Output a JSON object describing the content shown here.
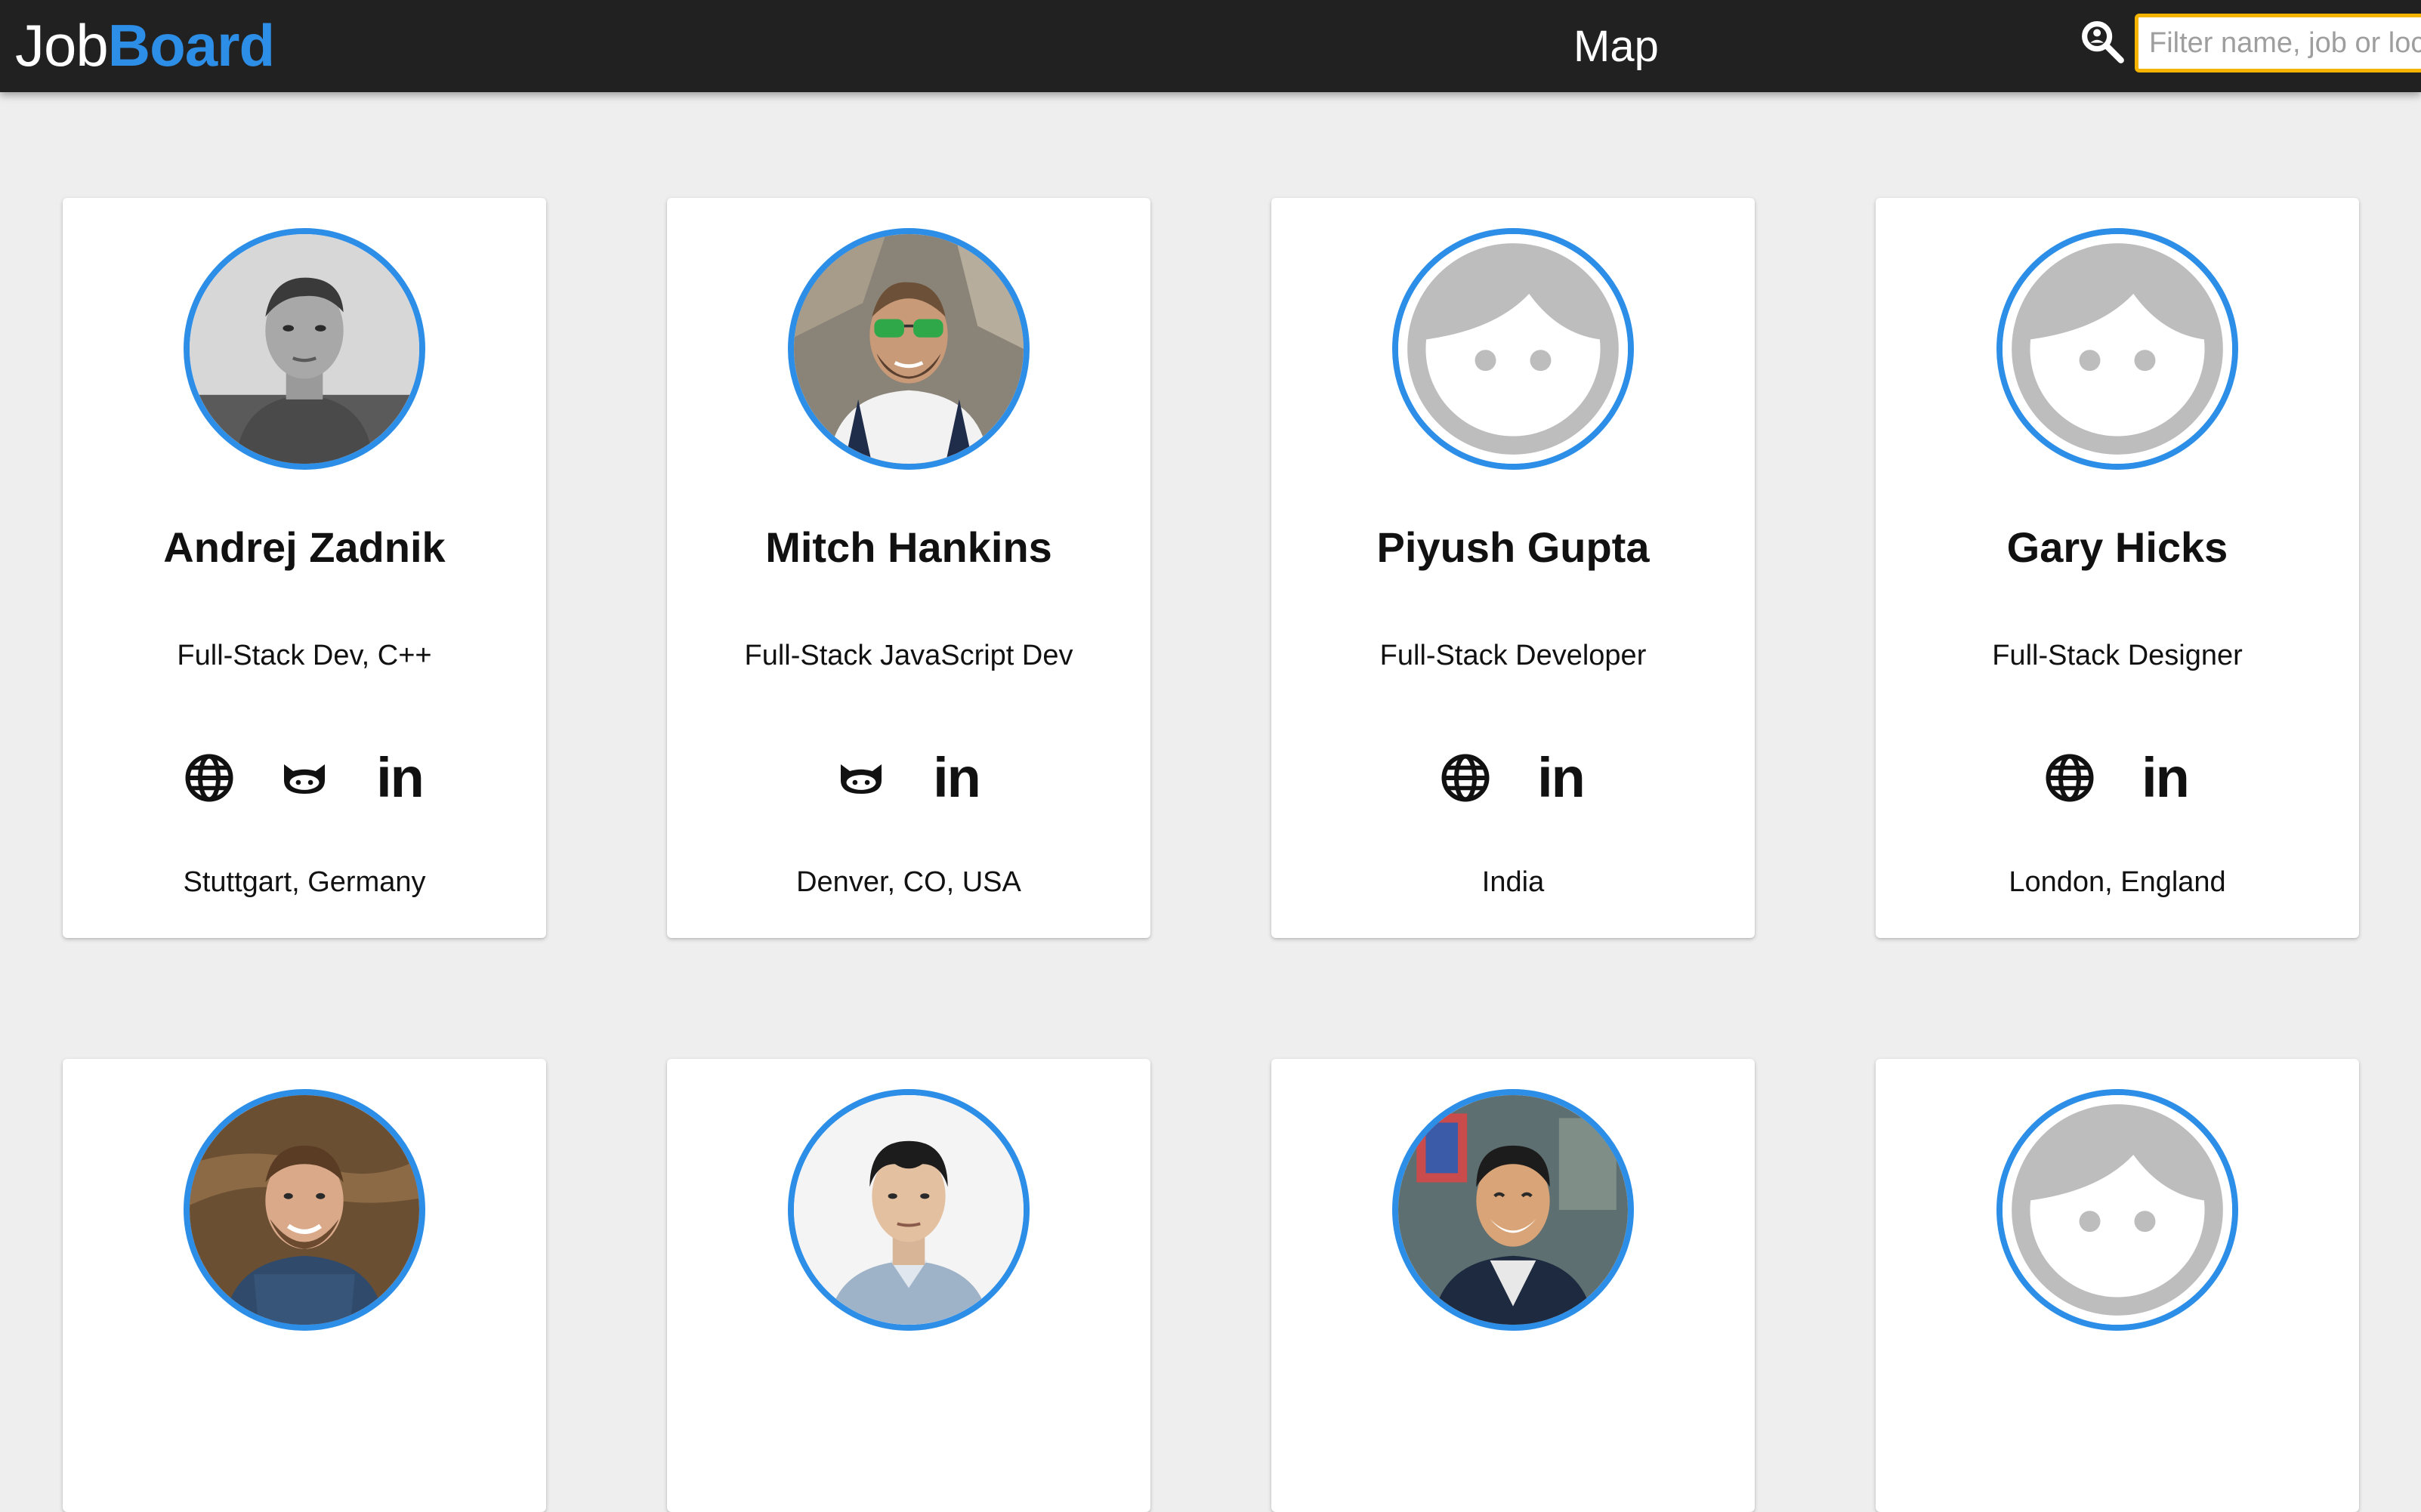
{
  "header": {
    "brand_part1": "Job",
    "brand_part2": "Board",
    "nav_map": "Map",
    "search_placeholder": "Filter name, job or location"
  },
  "colors": {
    "accent": "#2d8ee8",
    "topbar": "#212121",
    "search_border": "#f4b400",
    "background": "#eeeeee"
  },
  "profiles": [
    {
      "name": "Andrej Zadnik",
      "title": "Full-Stack Dev, C++",
      "location": "Stuttgart, Germany",
      "links": [
        "website-icon",
        "github-icon",
        "linkedin-icon"
      ],
      "avatar": "photo"
    },
    {
      "name": "Mitch Hankins",
      "title": "Full-Stack JavaScript Dev",
      "location": "Denver, CO, USA",
      "links": [
        "github-icon",
        "linkedin-icon"
      ],
      "avatar": "photo"
    },
    {
      "name": "Piyush Gupta",
      "title": "Full-Stack Developer",
      "location": "India",
      "links": [
        "website-icon",
        "linkedin-icon"
      ],
      "avatar": "placeholder"
    },
    {
      "name": "Gary Hicks",
      "title": "Full-Stack Designer",
      "location": "London, England",
      "links": [
        "website-icon",
        "linkedin-icon"
      ],
      "avatar": "placeholder"
    },
    {
      "avatar": "photo"
    },
    {
      "avatar": "photo"
    },
    {
      "avatar": "photo"
    },
    {
      "avatar": "placeholder"
    }
  ],
  "linkedin_text": "in"
}
